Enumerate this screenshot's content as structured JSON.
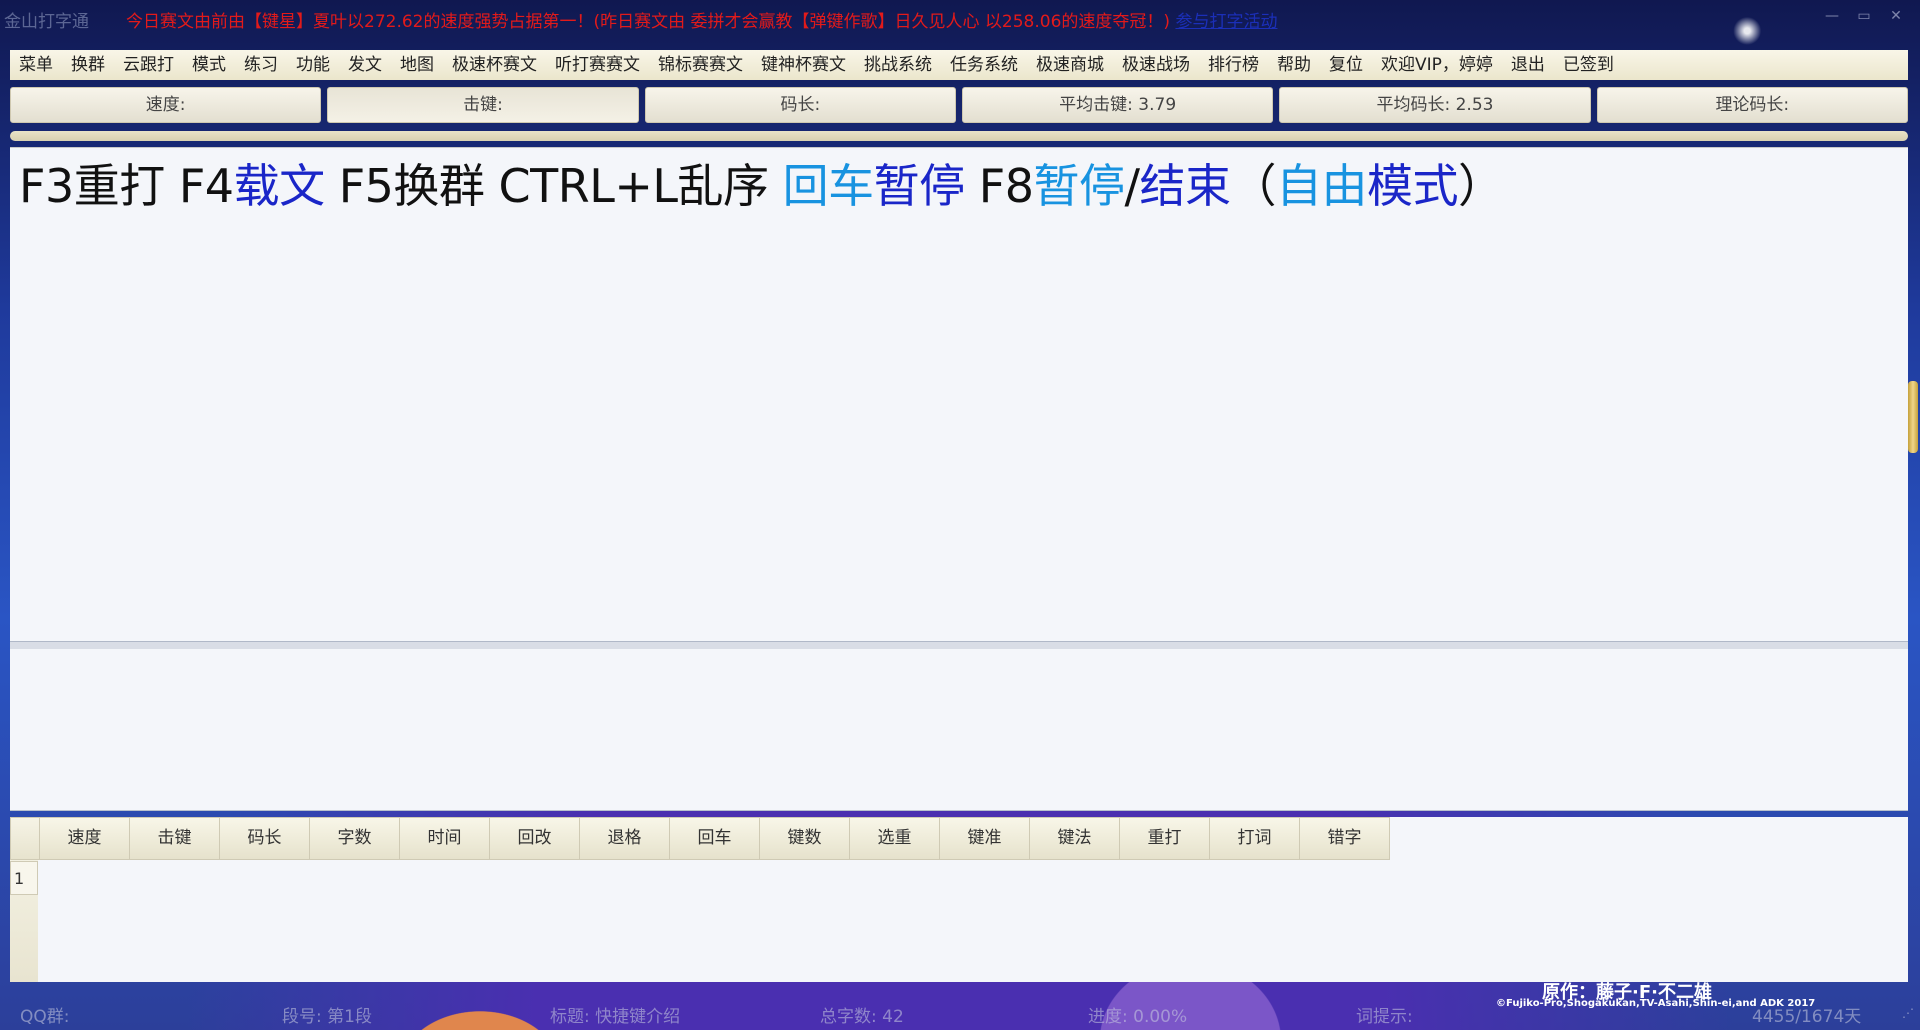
{
  "app": {
    "title": "金山打字通"
  },
  "marquee": {
    "text": "今日赛文由前由【键星】夏叶以272.62的速度强势占据第一！(昨日赛文由 委拼才会赢教【弹键作歌】日久见人心 以258.06的速度夺冠！)",
    "link": "参与打字活动"
  },
  "window_controls": [
    "—",
    "▭",
    "✕"
  ],
  "menu": {
    "items": [
      "菜单",
      "换群",
      "云跟打",
      "模式",
      "练习",
      "功能",
      "发文",
      "地图",
      "极速杯赛文",
      "听打赛赛文",
      "锦标赛赛文",
      "键神杯赛文",
      "挑战系统",
      "任务系统",
      "极速商城",
      "极速战场",
      "排行榜",
      "帮助",
      "复位",
      "欢迎VIP，婷婷",
      "退出",
      "已签到"
    ]
  },
  "stats": {
    "speed": "速度:",
    "keystroke": "击键:",
    "code_length": "码长:",
    "avg_keystroke": "平均击键: 3.79",
    "avg_code_length": "平均码长: 2.53",
    "theory_code_length": "理论码长:"
  },
  "prompt": {
    "segments": [
      "F3重打 F4",
      "载文",
      " F5换群 CTRL+L乱序 ",
      "回车",
      "暂停",
      " F8",
      "暂停",
      "/",
      "结束",
      "（",
      "自由",
      "模式",
      "）"
    ]
  },
  "results": {
    "columns": [
      "速度",
      "击键",
      "码长",
      "字数",
      "时间",
      "回改",
      "退格",
      "回车",
      "键数",
      "选重",
      "键准",
      "键法",
      "重打",
      "打词",
      "错字"
    ],
    "row_numbers": [
      "1"
    ]
  },
  "status": {
    "qq_group": "QQ群:",
    "segment": "段号: 第1段",
    "title": "标题: 快捷键介绍",
    "total_chars": "总字数: 42",
    "progress": "进度: 0.00%",
    "hint": "词提示:",
    "counter": "4455/1674天",
    "credit_line1": "原作：藤子·F·不二雄",
    "credit_line2": "©Fujiko-Pro,Shogakukan,TV-Asahi,Shin-ei,and ADK 2017"
  },
  "colors": {
    "marquee": "#e21a1a",
    "link": "#1b2fb8",
    "blue_text": "#1a26c8",
    "cyan_text": "#1893e0"
  }
}
